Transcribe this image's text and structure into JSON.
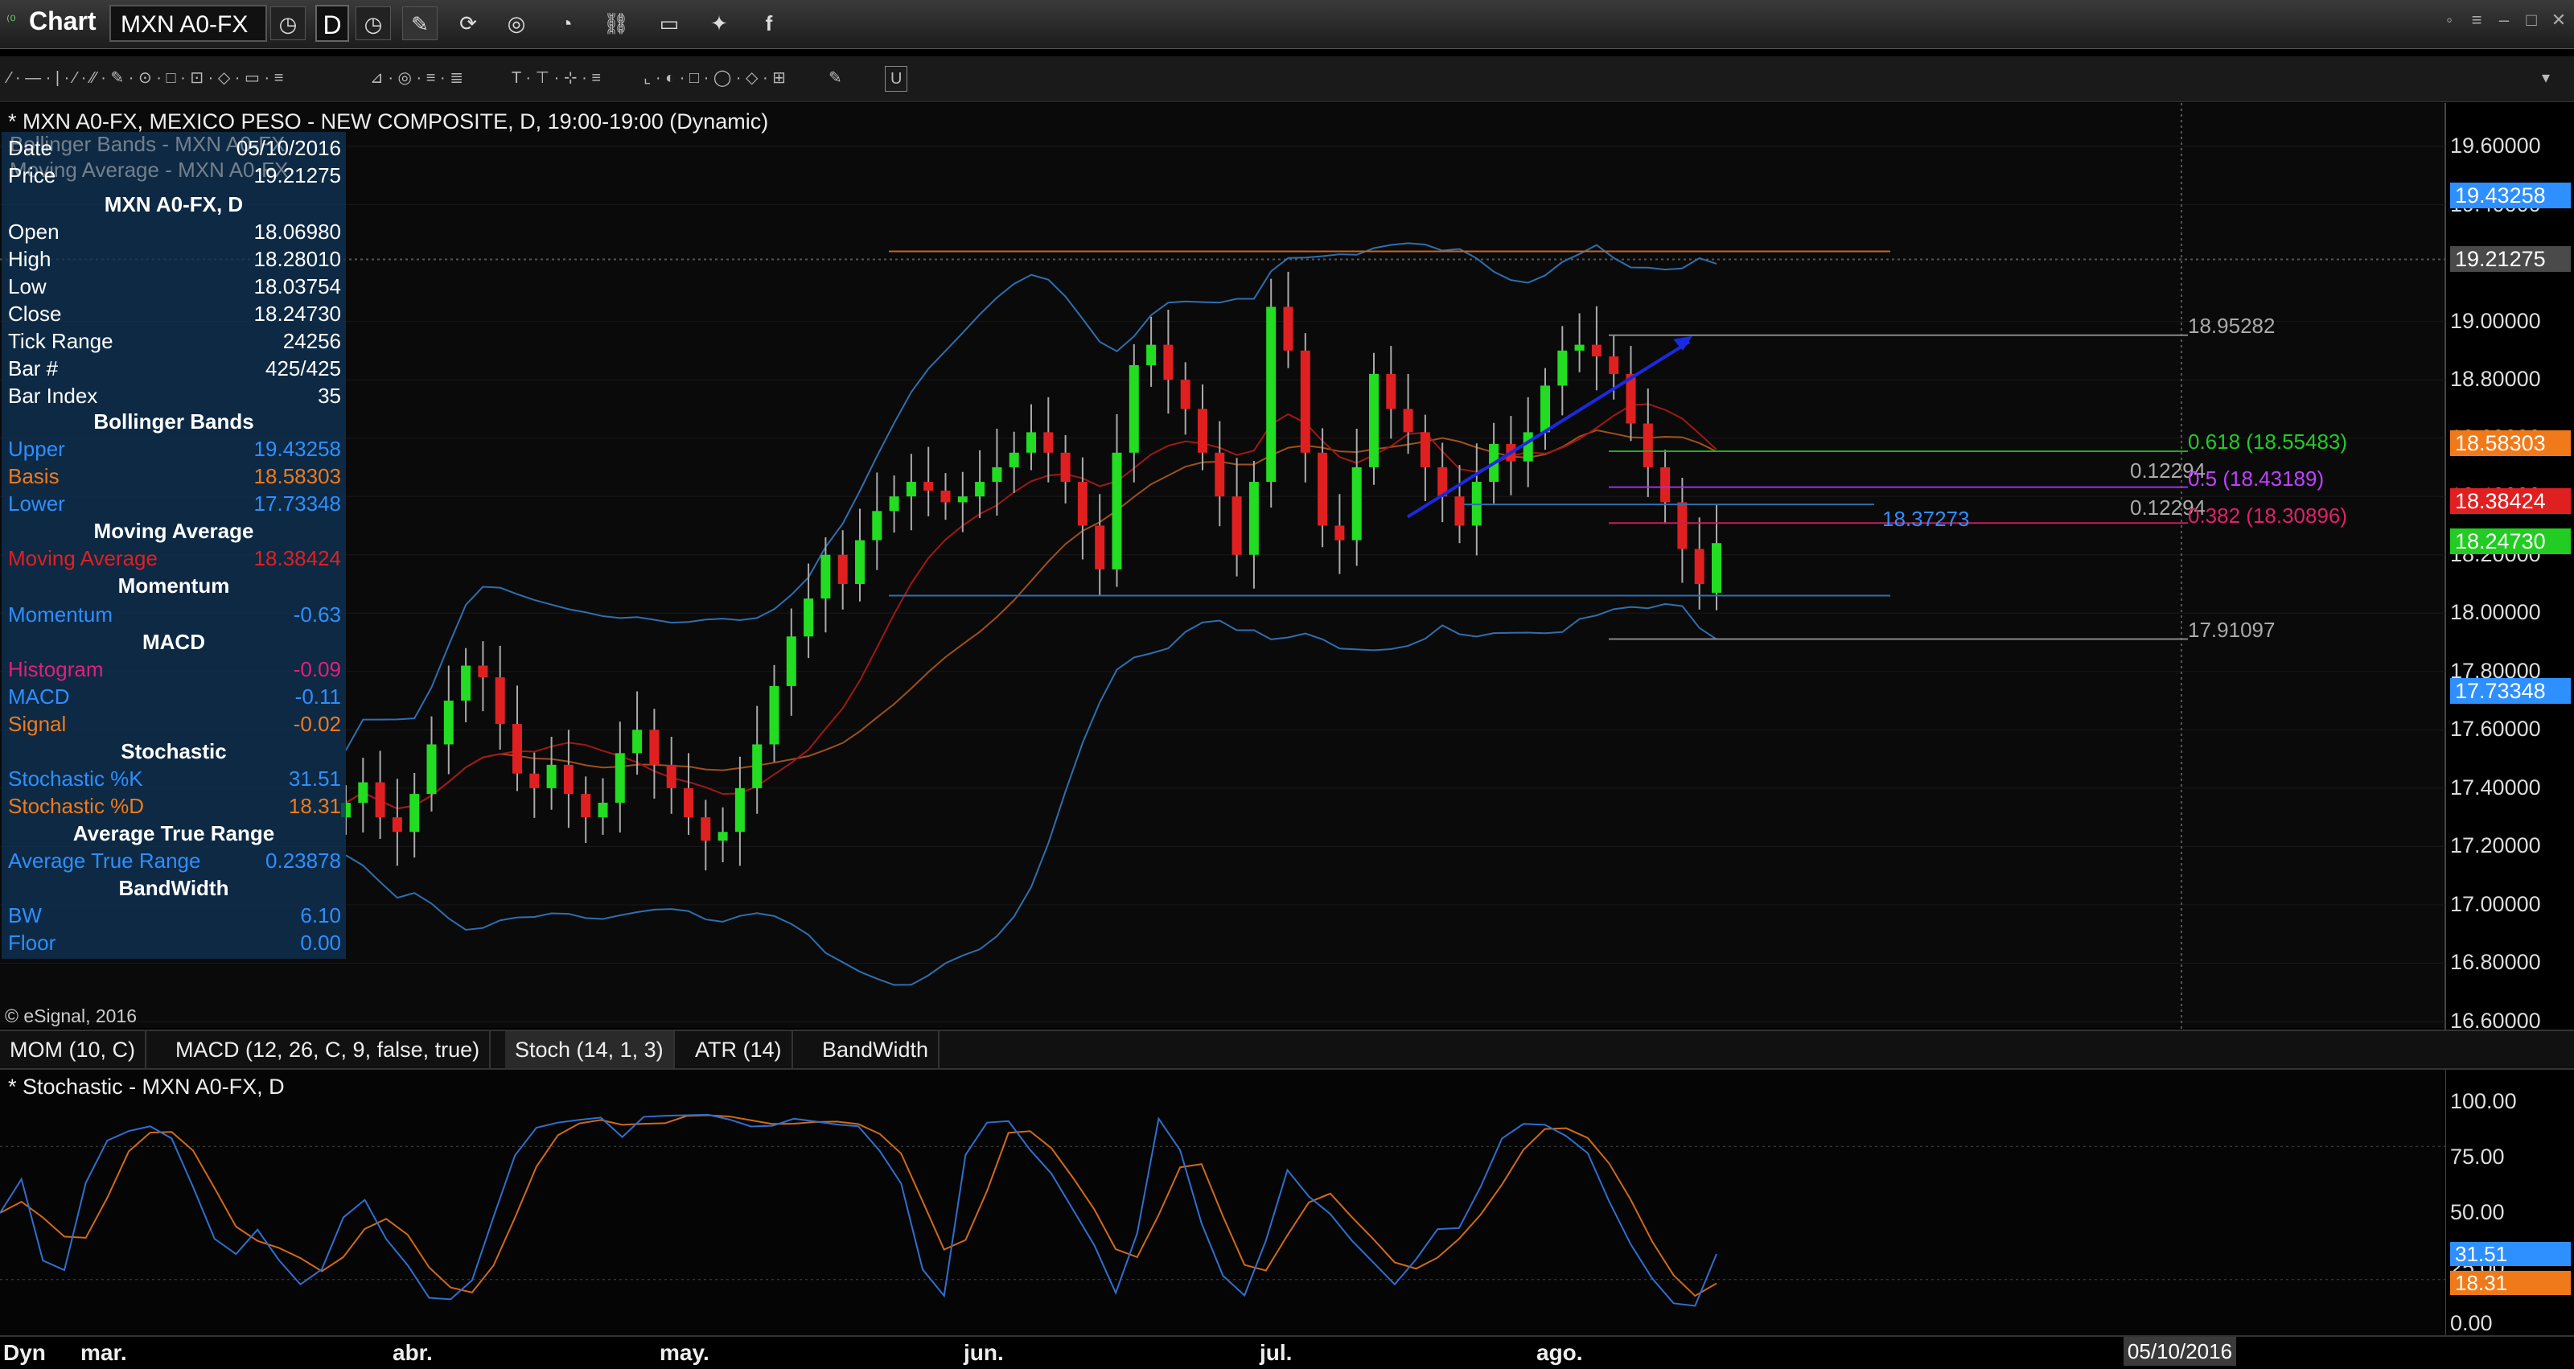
{
  "window": {
    "app_title": "Chart",
    "symbol": "MXN A0-FX",
    "interval": "D",
    "toolbar_icons": [
      "clock-icon",
      "clock-icon",
      "pencil-icon",
      "refresh-icon",
      "target-icon",
      "clock-icon",
      "link-icon",
      "chat-icon",
      "twitter-icon",
      "facebook-icon"
    ]
  },
  "drawing_toolbar": {
    "groups": [
      "⁄ · — · | · ⁄ · ⁄⁄ · ✎ · ⊙ · □ · ⊡ · ◇ · ▭ · ≡",
      "⊿ · ◎ · ≡ · ≣",
      "T · ⊤ · ⊹ · ≡",
      "⌞ · ◐ · □ · ◯ · ◇ · ⊞",
      "✎",
      "U"
    ]
  },
  "chart": {
    "header": "* MXN A0-FX, MEXICO PESO - NEW COMPOSITE, D, 19:00-19:00 (Dynamic)",
    "ghost_lines": [
      "Bollinger Bands - MXN A0-FX",
      "Moving Average - MXN A0-FX"
    ],
    "copyright": "© eSignal, 2016",
    "price_ticks": [
      "19.60000",
      "19.40000",
      "19.00000",
      "18.80000",
      "18.60000",
      "18.40000",
      "18.20000",
      "18.00000",
      "17.80000",
      "17.60000",
      "17.40000",
      "17.20000",
      "17.00000",
      "16.80000",
      "16.60000"
    ],
    "price_badges": [
      {
        "text": "19.43258",
        "color": "#2e8fff"
      },
      {
        "text": "19.21275",
        "color": "#4a4a4a"
      },
      {
        "text": "18.58303",
        "color": "#f07a1a"
      },
      {
        "text": "18.38424",
        "color": "#e02020"
      },
      {
        "text": "18.24730",
        "color": "#22cc22"
      },
      {
        "text": "17.73348",
        "color": "#2e8fff"
      }
    ],
    "fib_labels": {
      "top": "18.95282",
      "f618": "0.618 (18.55483)",
      "f500": "0.5 (18.43189)",
      "f382": "0.382 (18.30896)",
      "a": "0.12294",
      "b": "0.12294",
      "hline": "18.37273",
      "bottom": "17.91097"
    }
  },
  "data_window": {
    "rows_top": [
      {
        "label": "Date",
        "value": "05/10/2016"
      },
      {
        "label": "Price",
        "value": "19.21275"
      }
    ],
    "symbol_title": "MXN A0-FX, D",
    "rows_ohlc": [
      {
        "label": "Open",
        "value": "18.06980"
      },
      {
        "label": "High",
        "value": "18.28010"
      },
      {
        "label": "Low",
        "value": "18.03754"
      },
      {
        "label": "Close",
        "value": "18.24730"
      },
      {
        "label": "Tick Range",
        "value": "24256"
      },
      {
        "label": "Bar #",
        "value": "425/425"
      },
      {
        "label": "Bar Index",
        "value": "35"
      }
    ],
    "bollinger_title": "Bollinger Bands",
    "bollinger": [
      {
        "label": "Upper",
        "value": "19.43258",
        "color": "#2e8fff"
      },
      {
        "label": "Basis",
        "value": "18.58303",
        "color": "#f07a1a"
      },
      {
        "label": "Lower",
        "value": "17.73348",
        "color": "#2e8fff"
      }
    ],
    "ma_title": "Moving Average",
    "ma": {
      "label": "Moving Average",
      "value": "18.38424",
      "color": "#e02020"
    },
    "momentum_title": "Momentum",
    "momentum": {
      "label": "Momentum",
      "value": "-0.63",
      "color": "#2e8fff"
    },
    "macd_title": "MACD",
    "macd": [
      {
        "label": "Histogram",
        "value": "-0.09",
        "color": "#e0207a"
      },
      {
        "label": "MACD",
        "value": "-0.11",
        "color": "#2e8fff"
      },
      {
        "label": "Signal",
        "value": "-0.02",
        "color": "#f07a1a"
      }
    ],
    "stoch_title": "Stochastic",
    "stoch": [
      {
        "label": "Stochastic %K",
        "value": "31.51",
        "color": "#2e8fff"
      },
      {
        "label": "Stochastic %D",
        "value": "18.31",
        "color": "#f07a1a"
      }
    ],
    "atr_title": "Average True Range",
    "atr": {
      "label": "Average True Range",
      "value": "0.23878",
      "color": "#2e8fff"
    },
    "bw_title": "BandWidth",
    "bw": [
      {
        "label": "BW",
        "value": "6.10",
        "color": "#2e8fff"
      },
      {
        "label": "Floor",
        "value": "0.00",
        "color": "#2e8fff"
      }
    ]
  },
  "study_tabs": [
    "MOM (10, C)",
    "MACD (12, 26, C, 9, false, true)",
    "Stoch (14, 1, 3)",
    "ATR (14)",
    "BandWidth"
  ],
  "stochastic_pane": {
    "header": "* Stochastic - MXN A0-FX, D",
    "ticks": [
      "100.00",
      "75.00",
      "50.00",
      "25.00",
      "0.00"
    ],
    "badges": [
      {
        "text": "31.51",
        "color": "#2e8fff"
      },
      {
        "text": "18.31",
        "color": "#f07a1a"
      }
    ]
  },
  "time_axis": {
    "corner": "Dyn",
    "months": [
      "mar.",
      "abr.",
      "may.",
      "jun.",
      "jul.",
      "ago."
    ],
    "cursor_date": "05/10/2016"
  },
  "chart_data": {
    "type": "candlestick",
    "symbol": "MXN A0-FX",
    "interval": "D",
    "ylim": [
      16.6,
      19.7
    ],
    "x_labels": [
      "mar.",
      "abr.",
      "may.",
      "jun.",
      "jul.",
      "ago."
    ],
    "last_bar": {
      "date": "05/10/2016",
      "open": 18.0698,
      "high": 18.2801,
      "low": 18.03754,
      "close": 18.2473
    },
    "closes": [
      17.35,
      17.42,
      17.3,
      17.25,
      17.38,
      17.55,
      17.7,
      17.82,
      17.78,
      17.62,
      17.45,
      17.4,
      17.48,
      17.38,
      17.3,
      17.35,
      17.52,
      17.6,
      17.48,
      17.4,
      17.3,
      17.22,
      17.25,
      17.4,
      17.55,
      17.75,
      17.92,
      18.05,
      18.2,
      18.1,
      18.25,
      18.35,
      18.4,
      18.45,
      18.42,
      18.38,
      18.4,
      18.45,
      18.5,
      18.55,
      18.62,
      18.55,
      18.45,
      18.3,
      18.15,
      18.55,
      18.85,
      18.92,
      18.8,
      18.7,
      18.55,
      18.4,
      18.2,
      18.45,
      19.05,
      18.9,
      18.55,
      18.3,
      18.25,
      18.5,
      18.82,
      18.7,
      18.62,
      18.5,
      18.4,
      18.3,
      18.45,
      18.58,
      18.52,
      18.62,
      18.78,
      18.9,
      18.92,
      18.88,
      18.82,
      18.65,
      18.5,
      18.38,
      18.22,
      18.1,
      18.24
    ],
    "bollinger": {
      "upper_last": 19.43258,
      "basis_last": 18.58303,
      "lower_last": 17.73348
    },
    "moving_average_last": 18.38424,
    "stochastic": {
      "k_last": 31.51,
      "d_last": 18.31,
      "levels": [
        80,
        20
      ]
    }
  }
}
